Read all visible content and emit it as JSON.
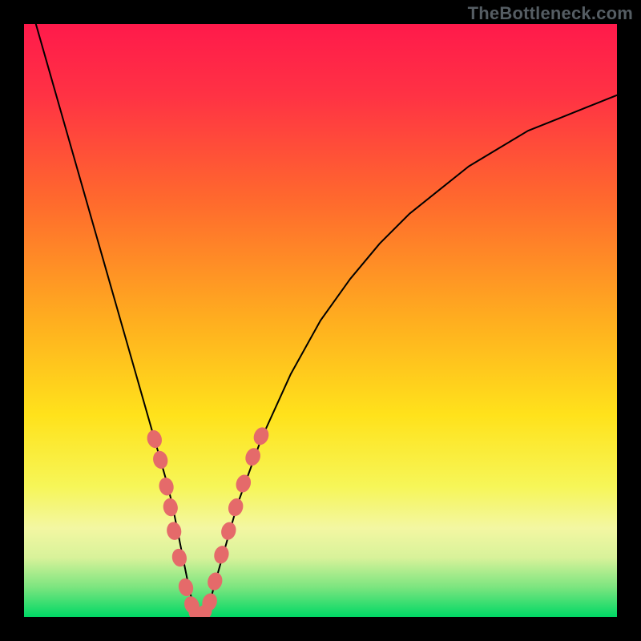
{
  "watermark": "TheBottleneck.com",
  "chart_data": {
    "type": "line",
    "title": "",
    "xlabel": "",
    "ylabel": "",
    "xlim": [
      0,
      100
    ],
    "ylim": [
      0,
      100
    ],
    "grid": false,
    "legend": false,
    "annotations": [],
    "background_gradient": {
      "stops": [
        {
          "offset": 0.0,
          "color": "#ff1a4b"
        },
        {
          "offset": 0.12,
          "color": "#ff3244"
        },
        {
          "offset": 0.3,
          "color": "#ff6a2d"
        },
        {
          "offset": 0.5,
          "color": "#ffae1f"
        },
        {
          "offset": 0.66,
          "color": "#ffe21b"
        },
        {
          "offset": 0.78,
          "color": "#f6f658"
        },
        {
          "offset": 0.85,
          "color": "#f3f7a2"
        },
        {
          "offset": 0.9,
          "color": "#d8f29a"
        },
        {
          "offset": 0.95,
          "color": "#7be57f"
        },
        {
          "offset": 1.0,
          "color": "#00d865"
        }
      ]
    },
    "series": [
      {
        "name": "bottleneck-curve",
        "stroke": "#000000",
        "stroke_width": 2,
        "x": [
          2,
          4,
          6,
          8,
          10,
          12,
          14,
          16,
          18,
          20,
          22,
          24,
          25,
          26,
          27,
          28,
          29,
          30,
          31,
          32,
          34,
          36,
          40,
          45,
          50,
          55,
          60,
          65,
          70,
          75,
          80,
          85,
          90,
          95,
          100
        ],
        "y": [
          100,
          93,
          86,
          79,
          72,
          65,
          58,
          51,
          44,
          37,
          30,
          23,
          19,
          14,
          9,
          4,
          1,
          0,
          1,
          5,
          12,
          19,
          30,
          41,
          50,
          57,
          63,
          68,
          72,
          76,
          79,
          82,
          84,
          86,
          88
        ]
      }
    ],
    "marker_points": {
      "name": "salmon-dots",
      "color": "#e56a6a",
      "radius": 9,
      "elongation": 1.25,
      "points": [
        {
          "x": 22.0,
          "y": 30.0
        },
        {
          "x": 23.0,
          "y": 26.5
        },
        {
          "x": 24.0,
          "y": 22.0
        },
        {
          "x": 24.7,
          "y": 18.5
        },
        {
          "x": 25.3,
          "y": 14.5
        },
        {
          "x": 26.2,
          "y": 10.0
        },
        {
          "x": 27.3,
          "y": 5.0
        },
        {
          "x": 28.3,
          "y": 2.0
        },
        {
          "x": 29.2,
          "y": 0.5
        },
        {
          "x": 30.3,
          "y": 0.7
        },
        {
          "x": 31.3,
          "y": 2.5
        },
        {
          "x": 32.2,
          "y": 6.0
        },
        {
          "x": 33.3,
          "y": 10.5
        },
        {
          "x": 34.5,
          "y": 14.5
        },
        {
          "x": 35.7,
          "y": 18.5
        },
        {
          "x": 37.0,
          "y": 22.5
        },
        {
          "x": 38.6,
          "y": 27.0
        },
        {
          "x": 40.0,
          "y": 30.5
        }
      ]
    }
  }
}
